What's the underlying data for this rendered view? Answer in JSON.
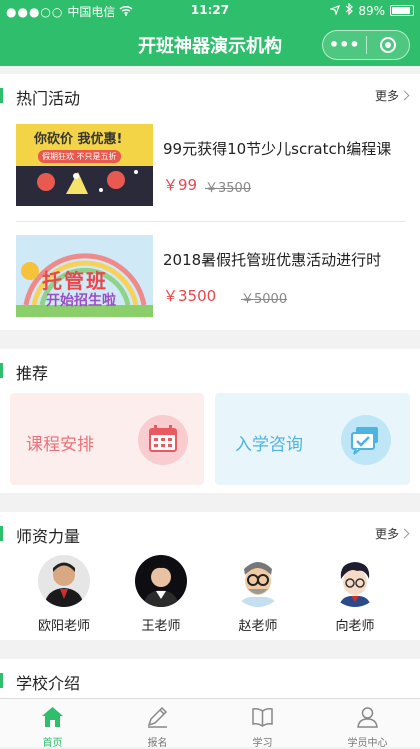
{
  "status_bar": {
    "carrier": "中国电信",
    "time": "11:27",
    "battery": "89%"
  },
  "navbar": {
    "title": "开班神器演示机构",
    "more_icon": "ellipsis-icon",
    "close_icon": "target-icon"
  },
  "hot": {
    "title": "热门活动",
    "more": "更多",
    "items": [
      {
        "name": "99元获得10节少儿scratch编程课",
        "price": "￥99",
        "old_price": "￥3500",
        "thumb_text_1": "你砍价 我优惠!",
        "thumb_text_2": "假期狂欢 不只是五折"
      },
      {
        "name": "2018暑假托管班优惠活动进行时",
        "price": "￥3500",
        "old_price": "￥5000",
        "thumb_text_1": "托管班",
        "thumb_text_2": "开始招生啦"
      }
    ]
  },
  "recommend": {
    "title": "推荐",
    "cards": [
      {
        "label": "课程安排",
        "icon": "calendar-icon",
        "bg": "#fdeeee",
        "color": "#e8747a"
      },
      {
        "label": "入学咨询",
        "icon": "chat-check-icon",
        "bg": "#e8f6fc",
        "color": "#4eb3e0"
      }
    ]
  },
  "teachers": {
    "title": "师资力量",
    "more": "更多",
    "list": [
      {
        "name": "欧阳老师"
      },
      {
        "name": "王老师"
      },
      {
        "name": "赵老师"
      },
      {
        "name": "向老师"
      }
    ]
  },
  "school": {
    "title": "学校介绍"
  },
  "tabbar": {
    "tabs": [
      {
        "label": "首页",
        "icon": "home-icon",
        "active": true
      },
      {
        "label": "报名",
        "icon": "pencil-icon",
        "active": false
      },
      {
        "label": "学习",
        "icon": "book-icon",
        "active": false
      },
      {
        "label": "学员中心",
        "icon": "user-icon",
        "active": false
      }
    ]
  },
  "colors": {
    "brand": "#2fbf6c",
    "price": "#e8474b"
  }
}
